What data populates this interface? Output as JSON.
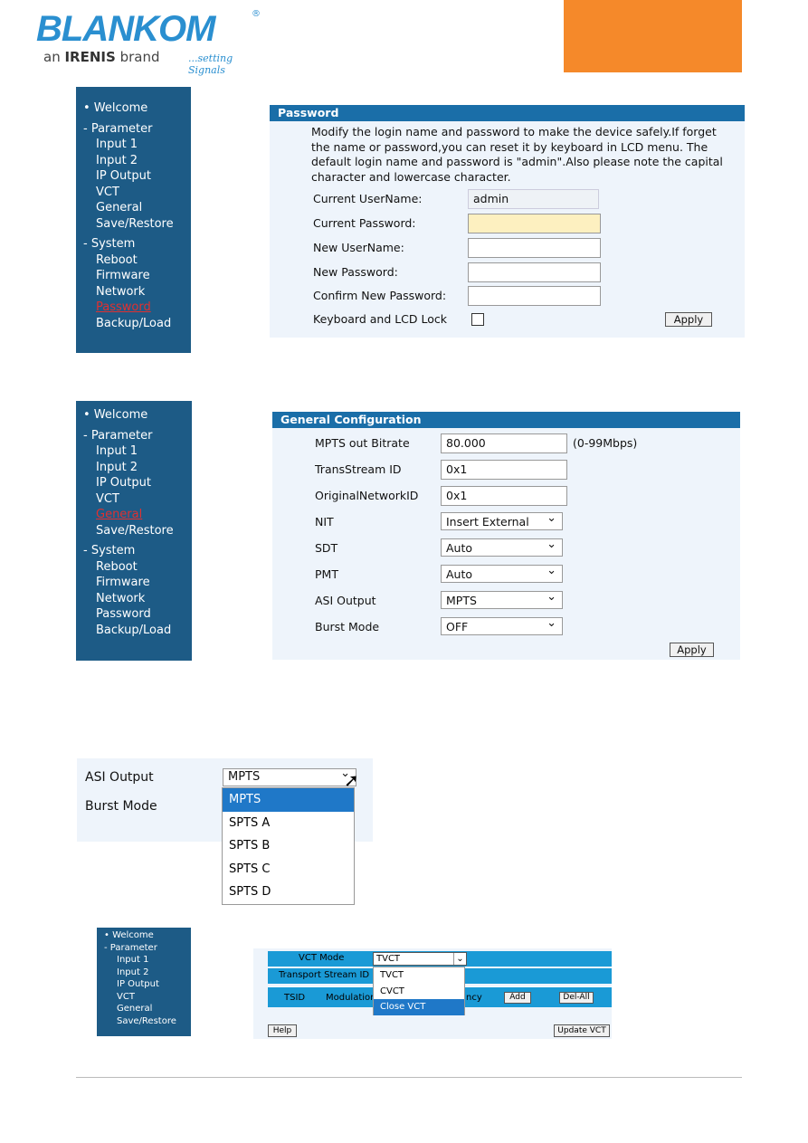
{
  "logo": {
    "brand": "BLANKOM",
    "registered": "®",
    "sub_prefix": "an ",
    "sub_brand": "IRENIS",
    "sub_suffix": " brand",
    "tagline": "...setting Signals"
  },
  "colors": {
    "accent_orange": "#f5892a",
    "sidebar": "#1d5b86",
    "header": "#1a6ea8",
    "highlight": "#1f78c8"
  },
  "nav1": [
    "Welcome",
    "Parameter",
    "Input 1",
    "Input 2",
    "IP Output",
    "VCT",
    "General",
    "Save/Restore",
    "System",
    "Reboot",
    "Firmware",
    "Network",
    "Password",
    "Backup/Load"
  ],
  "password": {
    "title": "Password",
    "description": "Modify the login name and password to make the device safely.If forget the name or password,you can reset it by keyboard in LCD menu. The default login name and password is \"admin\".Also please note the capital character and lowercase character.",
    "current_username_label": "Current UserName:",
    "current_username_value": "admin",
    "current_password_label": "Current Password:",
    "new_username_label": "New UserName:",
    "new_password_label": "New Password:",
    "confirm_password_label": "Confirm New Password:",
    "lock_label": "Keyboard and LCD Lock",
    "apply": "Apply"
  },
  "general": {
    "title": "General Configuration",
    "mpts_label": "MPTS out Bitrate",
    "mpts_value": "80.000",
    "mpts_hint": "(0-99Mbps)",
    "tsid_label": "TransStream ID",
    "tsid_value": "0x1",
    "onid_label": "OriginalNetworkID",
    "onid_value": "0x1",
    "nit_label": "NIT",
    "nit_value": "Insert External",
    "sdt_label": "SDT",
    "sdt_value": "Auto",
    "pmt_label": "PMT",
    "pmt_value": "Auto",
    "asi_label": "ASI Output",
    "asi_value": "MPTS",
    "burst_label": "Burst Mode",
    "burst_value": "OFF",
    "apply": "Apply"
  },
  "asi_dropdown": {
    "label": "ASI Output",
    "burst_label": "Burst Mode",
    "selected": "MPTS",
    "options": [
      "MPTS",
      "SPTS A",
      "SPTS B",
      "SPTS C",
      "SPTS D"
    ]
  },
  "nav3": [
    "Welcome",
    "Parameter",
    "Input 1",
    "Input 2",
    "IP Output",
    "VCT",
    "General",
    "Save/Restore"
  ],
  "vct": {
    "mode_label": "VCT Mode",
    "mode_value": "TVCT",
    "options": [
      "TVCT",
      "CVCT",
      "Close VCT"
    ],
    "tsid_label": "Transport Stream ID",
    "col_tsid": "TSID",
    "col_modulation": "Modulation",
    "col_frequency": "ncy",
    "add": "Add",
    "del_all": "Del-All",
    "help": "Help",
    "update": "Update VCT"
  }
}
